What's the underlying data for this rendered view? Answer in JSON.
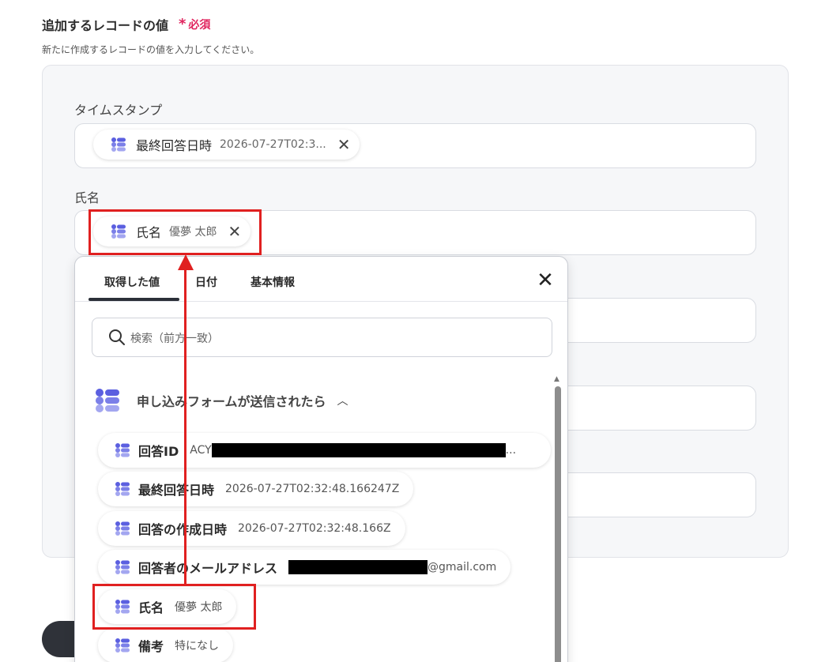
{
  "section": {
    "title": "追加するレコードの値",
    "required_mark": "*",
    "required_label": "必須",
    "description": "新たに作成するレコードの値を入力してください。"
  },
  "fields": {
    "timestamp": {
      "label": "タイムスタンプ",
      "chip_name": "最終回答日時",
      "chip_value": "2026-07-27T02:3..."
    },
    "name": {
      "label": "氏名",
      "chip_name": "氏名",
      "chip_value": "優夢 太郎"
    }
  },
  "popup": {
    "tabs": [
      "取得した値",
      "日付",
      "基本情報"
    ],
    "active_tab": "取得した値",
    "search_placeholder": "検索（前方一致）",
    "group_title": "申し込みフォームが送信されたら",
    "items": [
      {
        "name": "回答ID",
        "value": "ACY",
        "value_suffix": "..."
      },
      {
        "name": "最終回答日時",
        "value": "2026-07-27T02:32:48.166247Z"
      },
      {
        "name": "回答の作成日時",
        "value": "2026-07-27T02:32:48.166Z"
      },
      {
        "name": "回答者のメールアドレス",
        "value": "@gmail.com"
      },
      {
        "name": "氏名",
        "value": "優夢 太郎"
      },
      {
        "name": "備考",
        "value": "特になし"
      }
    ]
  },
  "icons": {
    "chip_icon": "form-icon",
    "close": "close-icon",
    "search": "search-icon",
    "chevron": "chevron-up-icon"
  },
  "colors": {
    "accent": "#5b5fe0",
    "highlight": "#e02020",
    "required": "#e0245e"
  }
}
